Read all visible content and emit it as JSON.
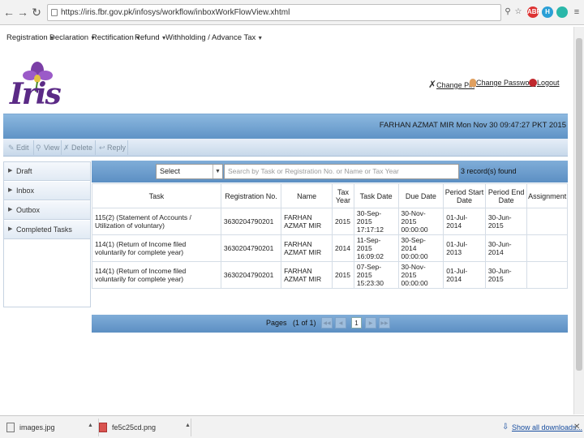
{
  "browser": {
    "url": "https://iris.fbr.gov.pk/infosys/workflow/inboxWorkFlowView.xhtml",
    "back_icon": "arrow-left-icon",
    "forward_icon": "arrow-right-icon",
    "reload_icon": "reload-icon",
    "ext_badge": "ABP",
    "ext_h": "H"
  },
  "menu": [
    {
      "label": "Registration"
    },
    {
      "label": "Declaration"
    },
    {
      "label": "Rectification"
    },
    {
      "label": "Refund"
    },
    {
      "label": "Withholding / Advance Tax"
    }
  ],
  "logo": {
    "text": "Iris"
  },
  "top_links": {
    "change_pin": "Change Pin",
    "change_password": "Change Password",
    "logout": "Logout"
  },
  "user_bar": {
    "text": "FARHAN AZMAT MIR  Mon Nov 30 09:47:27 PKT 2015"
  },
  "toolbar": {
    "edit": "Edit",
    "view": "View",
    "delete": "Delete",
    "reply": "Reply"
  },
  "sidebar": [
    {
      "label": "Draft"
    },
    {
      "label": "Inbox"
    },
    {
      "label": "Outbox"
    },
    {
      "label": "Completed Tasks"
    }
  ],
  "filter": {
    "select_value": "Select",
    "search_placeholder": "Search by Task or Registration No. or Name or Tax Year",
    "records_found": "3 record(s) found"
  },
  "table": {
    "headers": [
      "Task",
      "Registration No.",
      "Name",
      "Tax Year",
      "Task Date",
      "Due Date",
      "Period Start Date",
      "Period End Date",
      "Assignment"
    ],
    "rows": [
      [
        "115(2) (Statement of Accounts / Utilization of voluntary)",
        "3630204790201",
        "FARHAN AZMAT MIR",
        "2015",
        "30-Sep-2015 17:17:12",
        "30-Nov-2015 00:00:00",
        "01-Jul-2014",
        "30-Jun-2015",
        ""
      ],
      [
        "114(1) (Return of Income filed voluntarily for complete year)",
        "3630204790201",
        "FARHAN AZMAT MIR",
        "2014",
        "11-Sep-2015 16:09:02",
        "30-Sep-2014 00:00:00",
        "01-Jul-2013",
        "30-Jun-2014",
        ""
      ],
      [
        "114(1) (Return of Income filed voluntarily for complete year)",
        "3630204790201",
        "FARHAN AZMAT MIR",
        "2015",
        "07-Sep-2015 15:23:30",
        "30-Nov-2015 00:00:00",
        "01-Jul-2014",
        "30-Jun-2015",
        ""
      ]
    ]
  },
  "pager": {
    "label": "Pages",
    "info": "(1 of 1)",
    "current": "1"
  },
  "downloads": {
    "item1": "images.jpg",
    "item2": "fe5c25cd.png",
    "show_all": "Show all downloads..."
  }
}
